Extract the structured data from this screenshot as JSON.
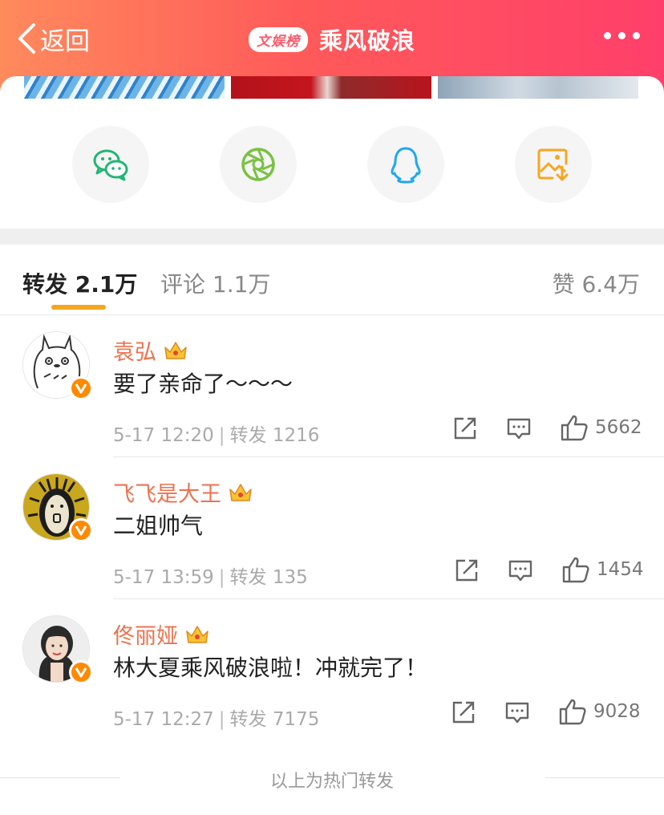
{
  "header": {
    "back_label": "返回",
    "badge": "文娱榜",
    "title": "乘风破浪"
  },
  "tabs": {
    "repost": "转发 2.1万",
    "comment": "评论 1.1万",
    "like": "赞 6.4万"
  },
  "colors": {
    "accent": "#f5a623",
    "username": "#eb7350",
    "wechat": "#22b573",
    "moments": "#7ac143",
    "qq": "#1fa8f0",
    "save": "#f5a623"
  },
  "share": [
    "wechat-icon",
    "moments-icon",
    "qq-icon",
    "save-image-icon"
  ],
  "reposts": [
    {
      "username": "袁弘",
      "content": "要了亲命了～～～",
      "time": "5-17 12:20",
      "repost_label": "转发 1216",
      "likes": "5662"
    },
    {
      "username": "飞飞是大王",
      "content": "二姐帅气",
      "time": "5-17 13:59",
      "repost_label": "转发 135",
      "likes": "1454"
    },
    {
      "username": "佟丽娅",
      "content": "林大夏乘风破浪啦！冲就完了！",
      "time": "5-17 12:27",
      "repost_label": "转发 7175",
      "likes": "9028"
    }
  ],
  "footer": "以上为热门转发"
}
